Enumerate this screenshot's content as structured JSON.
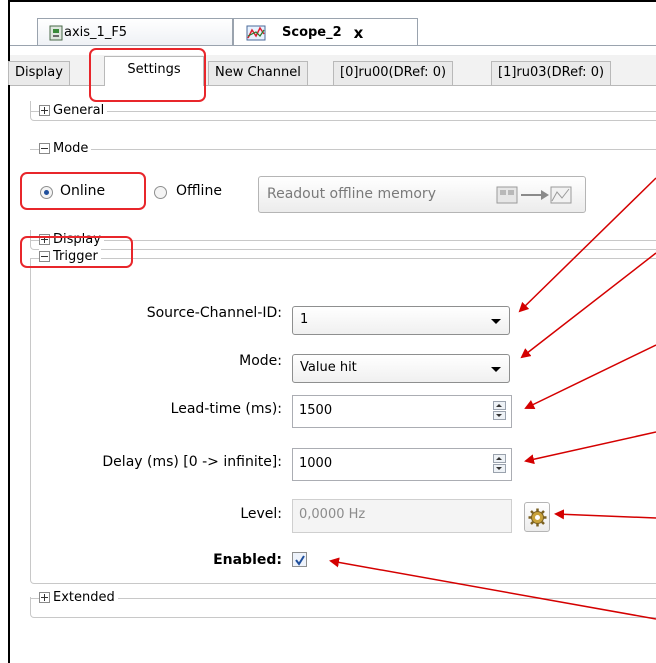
{
  "doc_tabs": [
    {
      "label": "axis_1_F5",
      "icon": "device-icon"
    },
    {
      "label": "Scope_2",
      "icon": "scope-icon",
      "close": "x",
      "active": true
    }
  ],
  "sub_tabs": [
    "Display",
    "Settings",
    "New Channel",
    "[0]ru00(DRef: 0)",
    "[1]ru03(DRef: 0)"
  ],
  "active_sub_tab": "Settings",
  "groups": {
    "general": "General",
    "mode": "Mode",
    "display": "Display",
    "trigger": "Trigger",
    "extended": "Extended"
  },
  "mode": {
    "online_label": "Online",
    "offline_label": "Offline",
    "selected": "Online",
    "readout_button": "Readout offline memory"
  },
  "trigger": {
    "source_channel": {
      "label": "Source-Channel-ID:",
      "value": "1"
    },
    "mode": {
      "label": "Mode:",
      "value": "Value hit"
    },
    "lead_time": {
      "label": "Lead-time (ms):",
      "value": "1500"
    },
    "delay": {
      "label": "Delay (ms) [0 -> infinite]:",
      "value": "1000"
    },
    "level": {
      "label": "Level:",
      "value": "0,0000 Hz"
    },
    "enabled": {
      "label": "Enabled:",
      "checked": true
    }
  },
  "colors": {
    "highlight": "#e8262b",
    "arrow": "#d40000",
    "accent": "#1f4f9c"
  }
}
